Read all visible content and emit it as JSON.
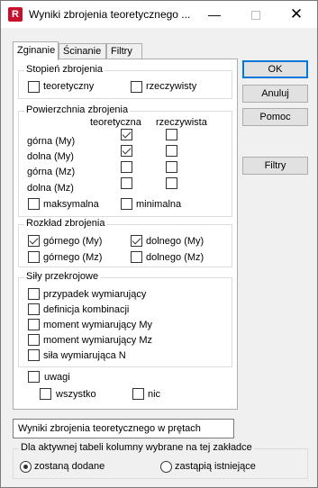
{
  "window": {
    "title": "Wyniki zbrojenia teoretycznego ...",
    "app_icon_letter": "R",
    "minimize_label": "—",
    "close_label": "✕"
  },
  "tabs": [
    "Zginanie",
    "Ścinanie",
    "Filtry"
  ],
  "stopien": {
    "title": "Stopień zbrojenia",
    "teoretyczny": "teoretyczny",
    "rzeczywisty": "rzeczywisty"
  },
  "powierzchnia": {
    "title": "Powierzchnia zbrojenia",
    "col_teoretyczna": "teoretyczna",
    "col_rzeczywista": "rzeczywista",
    "rows": [
      {
        "label": "górna (My)",
        "teor": true,
        "rzecz": false
      },
      {
        "label": "dolna (My)",
        "teor": true,
        "rzecz": false
      },
      {
        "label": "górna (Mz)",
        "teor": false,
        "rzecz": false
      },
      {
        "label": "dolna (Mz)",
        "teor": false,
        "rzecz": false
      }
    ],
    "maksymalna": "maksymalna",
    "minimalna": "minimalna"
  },
  "rozklad": {
    "title": "Rozkład zbrojenia",
    "gorny_my": "górnego (My)",
    "dolny_my": "dolnego (My)",
    "gorny_mz": "górnego (Mz)",
    "dolny_mz": "dolnego (Mz)"
  },
  "sily": {
    "title": "Siły przekrojowe",
    "items": [
      "przypadek wymiarujący",
      "definicja kombinacji",
      "moment wymiarujący My",
      "moment wymiarujący Mz",
      "siła wymiarująca N"
    ]
  },
  "uwagi": {
    "label": "uwagi",
    "wszystko": "wszystko",
    "nic": "nic"
  },
  "buttons": {
    "ok": "OK",
    "anuluj": "Anuluj",
    "pomoc": "Pomoc",
    "filtry": "Filtry"
  },
  "table_name": "Wyniki zbrojenia teoretycznego w prętach",
  "columns_group": {
    "title": "Dla aktywnej tabeli kolumny wybrane na tej zakładce",
    "option_add": "zostaną dodane",
    "option_replace": "zastąpią istniejące",
    "selected": "option_add"
  }
}
